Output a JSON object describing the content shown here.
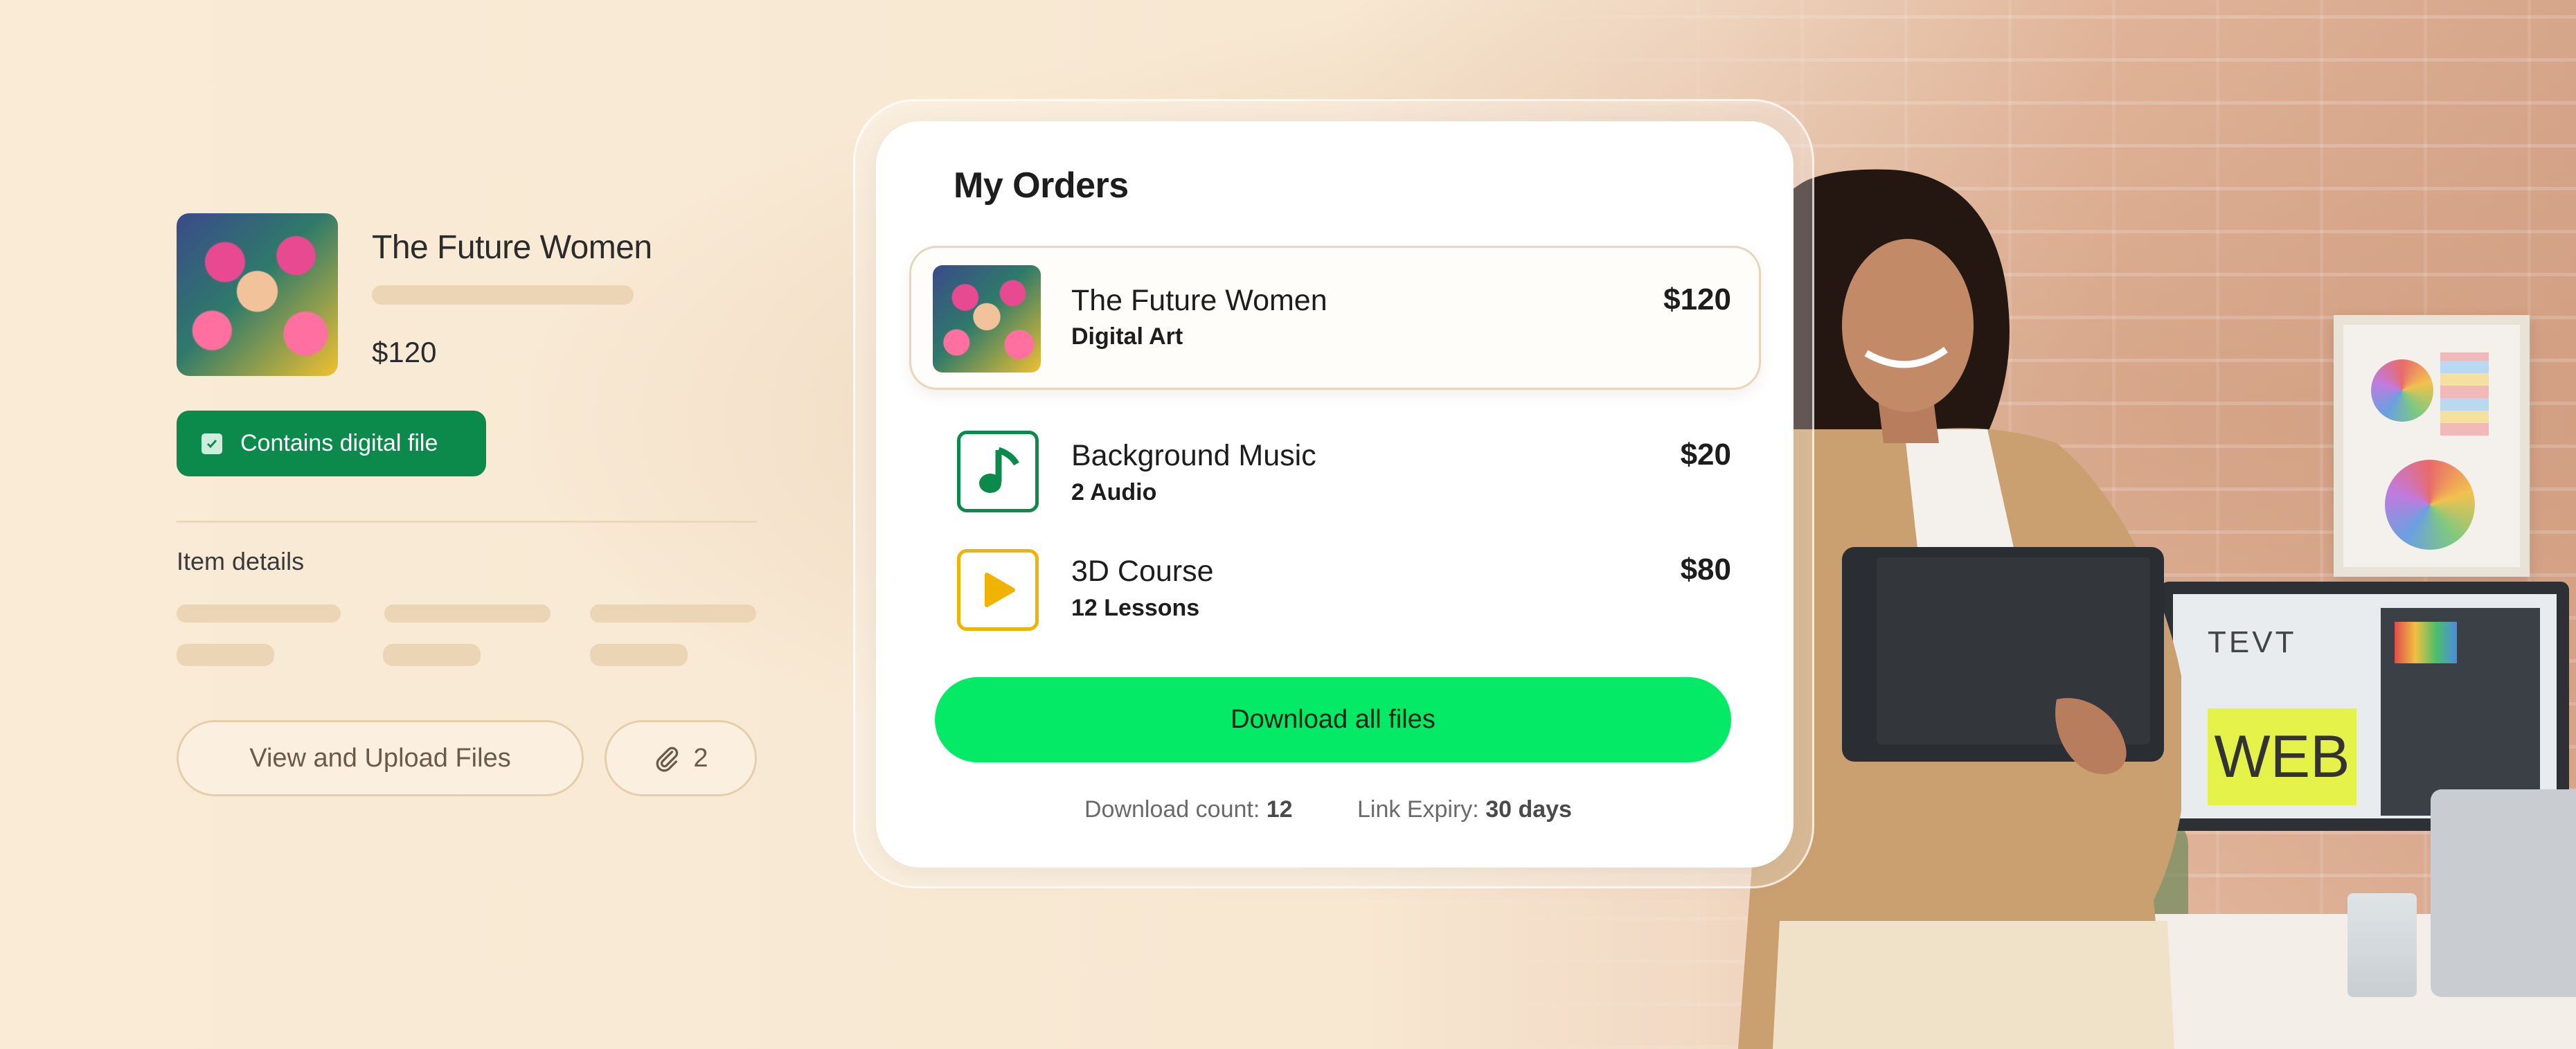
{
  "product": {
    "title": "The Future Women",
    "price": "$120",
    "thumbnail_icon": "digital-art-thumbnail",
    "badge_label": "Contains digital file",
    "details_heading": "Item details",
    "view_upload_label": "View and Upload Files",
    "attachment_count": "2"
  },
  "orders": {
    "title": "My Orders",
    "items": [
      {
        "name": "The Future Women",
        "type": "Digital Art",
        "price": "$120",
        "icon": "digital-art-thumbnail"
      },
      {
        "name": "Background Music",
        "type": "2 Audio",
        "price": "$20",
        "icon": "music-note-icon",
        "color": "#0b8a4b"
      },
      {
        "name": "3D Course",
        "type": "12 Lessons",
        "price": "$80",
        "icon": "play-icon",
        "color": "#f0b400"
      }
    ],
    "download_label": "Download all files",
    "download_count_label": "Download count:",
    "download_count": "12",
    "link_expiry_label": "Link Expiry:",
    "link_expiry": "30 days"
  },
  "scene": {
    "note_text": "WEB",
    "note_scribble": "TEVT"
  },
  "colors": {
    "background": "#f8e9d3",
    "badge_green": "#0b8a4b",
    "download_green": "#04ea67",
    "course_yellow": "#f0b400"
  }
}
